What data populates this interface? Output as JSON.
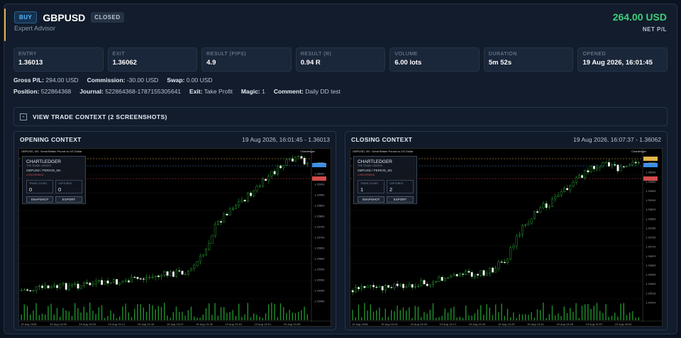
{
  "header": {
    "direction": "BUY",
    "symbol": "GBPUSD",
    "status": "CLOSED",
    "subtitle": "Expert Advisor",
    "net_value": "264.00 USD",
    "net_label": "NET P/L",
    "accent_color": "#e0b54a",
    "net_color": "#3ecf7a"
  },
  "stats": [
    {
      "label": "ENTRY",
      "value": "1.36013"
    },
    {
      "label": "EXIT",
      "value": "1.36062"
    },
    {
      "label": "RESULT (PIPS)",
      "value": "4.9"
    },
    {
      "label": "RESULT (R)",
      "value": "0.94 R"
    },
    {
      "label": "VOLUME",
      "value": "6.00 lots"
    },
    {
      "label": "DURATION",
      "value": "5m 52s"
    },
    {
      "label": "OPENED",
      "value": "19 Aug 2026, 16:01:45"
    }
  ],
  "meta1": {
    "gross_label": "Gross P/L:",
    "gross_value": "294.00 USD",
    "commission_label": "Commission:",
    "commission_value": "-30.00 USD",
    "swap_label": "Swap:",
    "swap_value": "0.00 USD"
  },
  "meta2": {
    "position_label": "Position:",
    "position_value": "522864368",
    "journal_label": "Journal:",
    "journal_value": "522864368-1787155305641",
    "exit_label": "Exit:",
    "exit_value": "Take Profit",
    "magic_label": "Magic:",
    "magic_value": "1",
    "comment_label": "Comment:",
    "comment_value": "Daily DD test"
  },
  "context_toggle": {
    "symbol": "-",
    "label": "VIEW TRADE CONTEXT (2 SCREENSHOTS)"
  },
  "panels": [
    {
      "title": "OPENING CONTEXT",
      "info": "19 Aug 2026, 16:01:45 - 1.36013",
      "chart_header": "GBPUSD, M1:  Great Britain Pound vs US Dollar",
      "chart_brand": "Chartledger",
      "overlay": {
        "title": "CHARTLEDGER",
        "sub": "THE TRADE LEDGER",
        "symbol": "GBPUSD / PERIOD_M1",
        "recording": "● RECORDING",
        "trade_count_label": "TRADE COUNT",
        "trade_count": "0",
        "captures_label": "CAPTURES",
        "captures": "0",
        "snapshot": "SNAPSHOT",
        "export": "EXPORT"
      },
      "price_labels": [
        "1.36060",
        "1.36000",
        "1.35950",
        "1.35900",
        "1.35850",
        "1.35800",
        "1.35750",
        "1.35700",
        "1.35650",
        "1.35600",
        "1.35550",
        "1.35500",
        "1.35450",
        "1.35400"
      ],
      "time_labels": [
        "19 Aug 2026",
        "19 Aug 14:59",
        "19 Aug 15:03",
        "19 Aug 15:11",
        "19 Aug 15:19",
        "19 Aug 15:27",
        "19 Aug 15:35",
        "19 Aug 15:43",
        "19 Aug 15:51",
        "19 Aug 15:59"
      ]
    },
    {
      "title": "CLOSING CONTEXT",
      "info": "19 Aug 2026, 16:07:37 - 1.36062",
      "chart_header": "GBPUSD, M1:  Great Britain Pound vs US Dollar",
      "chart_brand": "Chartledger",
      "overlay": {
        "title": "CHARTLEDGER",
        "sub": "THE TRADE LEDGER",
        "symbol": "GBPUSD / PERIOD_M1",
        "recording": "● RECORDING",
        "trade_count_label": "TRADE COUNT",
        "trade_count": "1",
        "captures_label": "CAPTURES",
        "captures": "2",
        "snapshot": "SNAPSHOT",
        "export": "EXPORT"
      },
      "price_labels": [
        "1.36070",
        "1.36030",
        "1.35990",
        "1.35950",
        "1.35910",
        "1.35870",
        "1.35830",
        "1.35790",
        "1.35750",
        "1.35710",
        "1.35670",
        "1.35630",
        "1.35590",
        "1.35550",
        "1.35510",
        "1.35470"
      ],
      "time_labels": [
        "19 Aug 2026",
        "19 Aug 15:01",
        "19 Aug 15:09",
        "19 Aug 15:17",
        "19 Aug 15:25",
        "19 Aug 15:33",
        "19 Aug 15:41",
        "19 Aug 15:49",
        "19 Aug 15:57",
        "19 Aug 16:05"
      ]
    }
  ]
}
